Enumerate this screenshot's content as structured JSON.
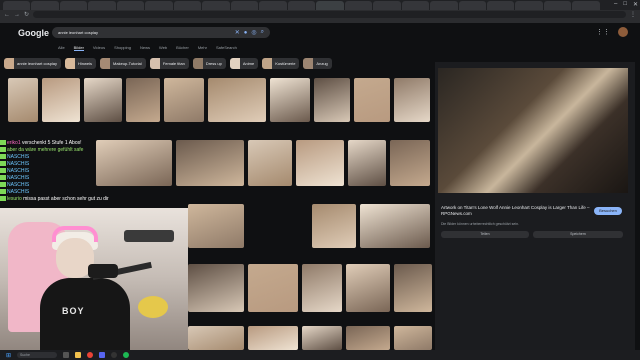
{
  "browser": {
    "tabs": [
      "",
      "",
      "",
      "",
      "",
      "",
      "",
      "",
      "",
      "",
      "",
      "",
      "",
      "",
      "",
      "",
      "",
      "",
      "",
      "",
      ""
    ],
    "url": "",
    "window_controls": [
      "–",
      "□",
      "✕"
    ]
  },
  "google": {
    "logo": "Google",
    "search_query": "annie leonhart cosplay",
    "nav_tabs": [
      {
        "label": "Alle"
      },
      {
        "label": "Bilder"
      },
      {
        "label": "Videos"
      },
      {
        "label": "Shopping"
      },
      {
        "label": "News"
      },
      {
        "label": "Web"
      },
      {
        "label": "Bücher"
      },
      {
        "label": "Mehr"
      },
      {
        "label": "SafeSearch"
      }
    ],
    "active_tab": "Bilder",
    "chips": [
      {
        "label": "annie leonhart cosplay"
      },
      {
        "label": "Hinweis"
      },
      {
        "label": "Makeup-Tutorial"
      },
      {
        "label": "Female titan"
      },
      {
        "label": "Dress up"
      },
      {
        "label": "Anime"
      },
      {
        "label": "Kostümerie"
      },
      {
        "label": "Anzug"
      }
    ]
  },
  "results": [
    {
      "caption": ""
    },
    {
      "caption": ""
    },
    {
      "caption": ""
    },
    {
      "caption": ""
    },
    {
      "caption": ""
    },
    {
      "caption": ""
    },
    {
      "caption": ""
    },
    {
      "caption": ""
    },
    {
      "caption": ""
    },
    {
      "caption": ""
    }
  ],
  "panel": {
    "title": "Artwork on Titan's Lone Wolf Annie Leonhart Cosplay is Larger Than Life – RPGNews.com",
    "source": "RPGNews.com",
    "note": "Die Bilder können urheberrechtlich geschützt sein.",
    "visit_label": "Besuchen",
    "share_label": "Teilen",
    "save_label": "Speichern"
  },
  "chat": [
    {
      "user": "eriko1",
      "text": "verschenkt 5 Stufe 1 Abos!",
      "color": "#ff6cc7"
    },
    {
      "user": "",
      "text": "aber da wäre mehrere gefühlt safe",
      "color": "#9ae66e"
    },
    {
      "user": "",
      "text": "NASCHIS",
      "color": "#6ec8ff"
    },
    {
      "user": "",
      "text": "NASCHIS",
      "color": "#6ec8ff"
    },
    {
      "user": "",
      "text": "NASCHIS",
      "color": "#6ec8ff"
    },
    {
      "user": "",
      "text": "NASCHIS",
      "color": "#6ec8ff"
    },
    {
      "user": "",
      "text": "NASCHIS",
      "color": "#6ec8ff"
    },
    {
      "user": "",
      "text": "NASCHIS",
      "color": "#6ec8ff"
    },
    {
      "user": "lesurio",
      "text": "missa passt aber schon sehr gut zu dir",
      "color": "#9ae66e"
    }
  ],
  "webcam": {
    "shirt_text": "BOY"
  },
  "taskbar": {
    "search_placeholder": "Suche",
    "clock": ""
  }
}
